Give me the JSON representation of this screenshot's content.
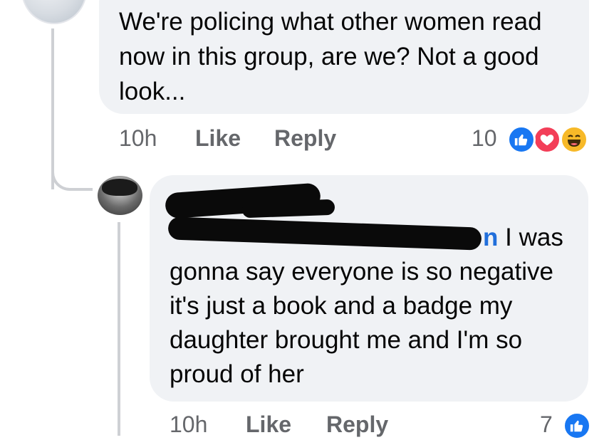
{
  "comment1": {
    "text": "We're policing what other women read now in this group, are we? Not a good look...",
    "actions": {
      "time": "10h",
      "like": "Like",
      "reply": "Reply"
    },
    "reaction_count": "10",
    "reactions": [
      "like-icon",
      "love-icon",
      "haha-icon"
    ]
  },
  "comment2": {
    "mention_end": "n",
    "text_first_line": "I was",
    "text_rest": "gonna say everyone is so negative it's just a book and a badge my daughter brought me and I'm so proud of her",
    "actions": {
      "time": "10h",
      "like": "Like",
      "reply": "Reply"
    },
    "reaction_count": "7",
    "reactions": [
      "like-icon"
    ]
  },
  "colors": {
    "bubble": "#f0f2f5",
    "meta_text": "#65676b",
    "mention": "#216fdb",
    "like_blue": "#1877f2",
    "love_red": "#f33e58",
    "haha_yellow": "#f7b928",
    "thread_line": "#ced0d4"
  }
}
